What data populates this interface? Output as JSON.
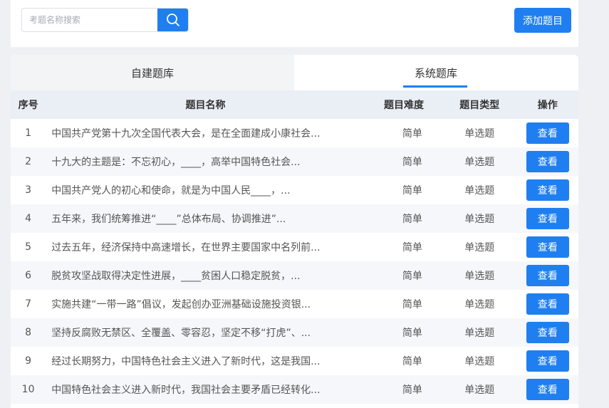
{
  "search": {
    "placeholder": "考题名称搜索",
    "value": ""
  },
  "toolbar": {
    "add_label": "添加题目"
  },
  "tabs": [
    {
      "label": "自建题库",
      "active": false
    },
    {
      "label": "系统题库",
      "active": true
    }
  ],
  "table": {
    "headers": {
      "num": "序号",
      "title": "题目名称",
      "difficulty": "题目难度",
      "type": "题目类型",
      "action": "操作"
    },
    "rows": [
      {
        "num": "1",
        "title": "中国共产党第十九次全国代表大会，是在全面建成小康社会...",
        "difficulty": "简单",
        "type": "单选题",
        "action": "查看"
      },
      {
        "num": "2",
        "title": "十九大的主题是：不忘初心，____，高举中国特色社会...",
        "difficulty": "简单",
        "type": "单选题",
        "action": "查看"
      },
      {
        "num": "3",
        "title": "中国共产党人的初心和使命，就是为中国人民____，...",
        "difficulty": "简单",
        "type": "单选题",
        "action": "查看"
      },
      {
        "num": "4",
        "title": "五年来，我们统筹推进“____”总体布局、协调推进”...",
        "difficulty": "简单",
        "type": "单选题",
        "action": "查看"
      },
      {
        "num": "5",
        "title": "过去五年，经济保持中高速增长，在世界主要国家中名列前...",
        "difficulty": "简单",
        "type": "单选题",
        "action": "查看"
      },
      {
        "num": "6",
        "title": "脱贫攻坚战取得决定性进展，____贫困人口稳定脱贫，...",
        "difficulty": "简单",
        "type": "单选题",
        "action": "查看"
      },
      {
        "num": "7",
        "title": "实施共建“一带一路”倡议，发起创办亚洲基础设施投资银...",
        "difficulty": "简单",
        "type": "单选题",
        "action": "查看"
      },
      {
        "num": "8",
        "title": "坚持反腐败无禁区、全覆盖、零容忍，坚定不移“打虎”、...",
        "difficulty": "简单",
        "type": "单选题",
        "action": "查看"
      },
      {
        "num": "9",
        "title": "经过长期努力，中国特色社会主义进入了新时代，这是我国...",
        "difficulty": "简单",
        "type": "单选题",
        "action": "查看"
      },
      {
        "num": "10",
        "title": "中国特色社会主义进入新时代，我国社会主要矛盾已经转化...",
        "difficulty": "简单",
        "type": "单选题",
        "action": "查看"
      }
    ]
  },
  "colors": {
    "accent": "#1f7ff0",
    "header_bg": "#eaeef5",
    "page_bg": "#eef0f4"
  },
  "icons": {
    "search": "search-icon"
  }
}
